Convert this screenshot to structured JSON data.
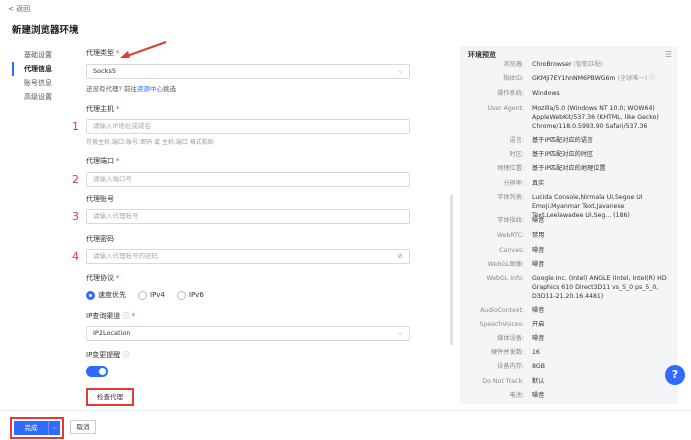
{
  "nav": {
    "back": "< 返回",
    "title": "新建浏览器环境"
  },
  "sidebar": {
    "items": [
      {
        "label": "基础设置"
      },
      {
        "label": "代理信息"
      },
      {
        "label": "账号信息"
      },
      {
        "label": "高级设置"
      }
    ]
  },
  "form": {
    "proxy_type_label": "代理类型",
    "proxy_type_value": "Socks5",
    "proxy_hint_prefix": "还没有代理? 前往",
    "proxy_hint_link": "资源中心",
    "proxy_hint_suffix": "挑选",
    "host_label": "代理主机",
    "host_placeholder": "请输入IP地址或域名",
    "host_hint": "可按主机:端口:账号:密码 或 主机:端口 格式粘贴",
    "port_label": "代理端口",
    "port_placeholder": "请输入端口号",
    "account_label": "代理账号",
    "account_placeholder": "请输入代理账号",
    "password_label": "代理密码",
    "password_placeholder": "请输入代理账号的密码",
    "protocol_label": "代理协议",
    "protocol_options": [
      "速度优先",
      "IPv4",
      "IPv6"
    ],
    "ip_channel_label": "IP查询渠道",
    "ip_channel_value": "IP2Location",
    "ip_alert_label": "IP变更提醒",
    "check_button": "检查代理",
    "markers": [
      "1",
      "2",
      "3",
      "4"
    ]
  },
  "preview": {
    "title": "环境预览",
    "rows": [
      {
        "k": "浏览器:",
        "v": "ChroBrowser",
        "g": "(智能匹配)"
      },
      {
        "k": "指纹ID:",
        "v": "GKMji7EY1hnNM6PBWG6m",
        "g": "(全球唯一) ⓘ"
      },
      {
        "k": "操作系统:",
        "v": "Windows"
      },
      {
        "k": "User Agent:",
        "v": "Mozilla/5.0 (Windows NT 10.0; WOW64) AppleWebKit/537.36 (KHTML, like Gecko) Chrome/118.0.5993.90 Safari/537.36"
      },
      {
        "k": "语言:",
        "v": "基于IP匹配对应的语言"
      },
      {
        "k": "时区:",
        "v": "基于IP匹配对应的时区"
      },
      {
        "k": "地理位置:",
        "v": "基于IP匹配对应的地理位置"
      },
      {
        "k": "分辨率:",
        "v": "真实"
      },
      {
        "k": "字体列表:",
        "v": "Lucida Console,Nirmala UI,Segoe UI Emoji,Myanmar Text,Javanese Text,Leelawadee UI,Seg... (186)"
      },
      {
        "k": "字体指纹:",
        "v": "噪音"
      },
      {
        "k": "WebRTC:",
        "v": "禁用"
      },
      {
        "k": "Canvas:",
        "v": "噪音"
      },
      {
        "k": "WebGL图像:",
        "v": "噪音"
      },
      {
        "k": "WebGL Info:",
        "v": "Google Inc. (Intel) ANGLE (Intel, Intel(R) HD Graphics 610 Direct3D11 vs_5_0 ps_5_0, D3D11-21.20.16.4481)"
      },
      {
        "k": "AudioContext:",
        "v": "噪音"
      },
      {
        "k": "SpeechVoices:",
        "v": "开启"
      },
      {
        "k": "媒体设备:",
        "v": "噪音"
      },
      {
        "k": "硬件并发数:",
        "v": "16"
      },
      {
        "k": "设备内存:",
        "v": "8GB"
      },
      {
        "k": "Do Not Track:",
        "v": "默认"
      },
      {
        "k": "电池:",
        "v": "噪音"
      }
    ]
  },
  "footer": {
    "done": "完成",
    "cancel": "取消"
  },
  "colors": {
    "accent": "#2f6bff",
    "highlight": "#e53935"
  }
}
